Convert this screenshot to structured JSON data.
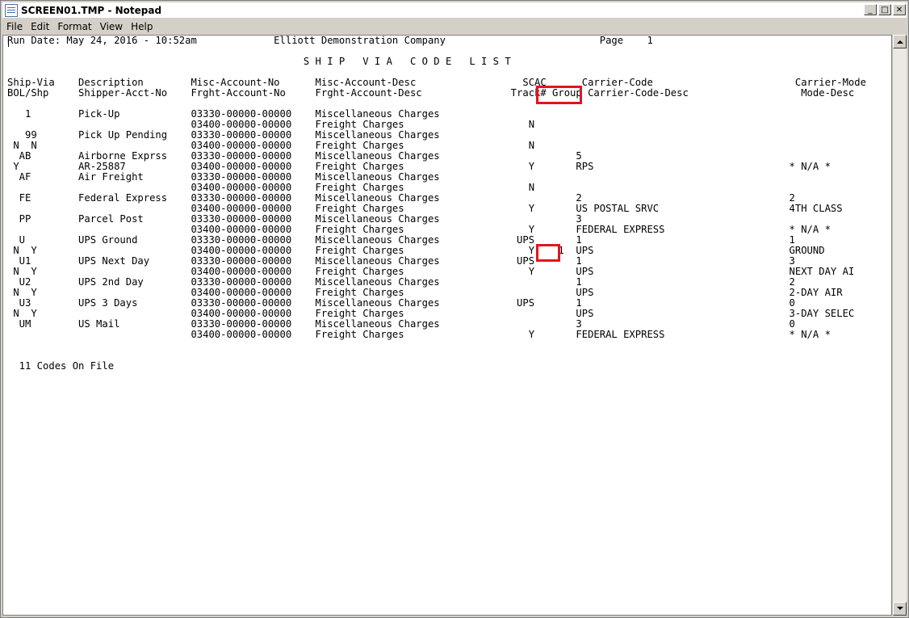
{
  "window": {
    "title": "SCREEN01.TMP - Notepad",
    "controls": {
      "minimize": "_",
      "maximize": "□",
      "close": "✕"
    }
  },
  "menu": [
    "File",
    "Edit",
    "Format",
    "View",
    "Help"
  ],
  "report": {
    "lines": [
      "Run Date: May 24, 2016 - 10:52am             Elliott Demonstration Company                          Page    1",
      "",
      "                                                  S H I P   V I A   C O D E   L I S T",
      "",
      "Ship-Via    Description        Misc-Account-No      Misc-Account-Desc                  SCAC      Carrier-Code                        Carrier-Mode",
      "BOL/Shp     Shipper-Acct-No    Frght-Account-No     Frght-Account-Desc               Track# Group Carrier-Code-Desc                   Mode-Desc",
      "",
      "   1        Pick-Up            03330-00000-00000    Miscellaneous Charges",
      "                               03400-00000-00000    Freight Charges                     N",
      "   99       Pick Up Pending    03330-00000-00000    Miscellaneous Charges",
      " N  N                          03400-00000-00000    Freight Charges                     N",
      "  AB        Airborne Exprss    03330-00000-00000    Miscellaneous Charges                       5",
      " Y          AR-25887           03400-00000-00000    Freight Charges                     Y       RPS                                 * N/A *",
      "  AF        Air Freight        03330-00000-00000    Miscellaneous Charges",
      "                               03400-00000-00000    Freight Charges                     N",
      "  FE        Federal Express    03330-00000-00000    Miscellaneous Charges                       2                                   2",
      "                               03400-00000-00000    Freight Charges                     Y       US POSTAL SRVC                      4TH CLASS",
      "  PP        Parcel Post        03330-00000-00000    Miscellaneous Charges                       3",
      "                               03400-00000-00000    Freight Charges                     Y       FEDERAL EXPRESS                     * N/A *",
      "  U         UPS Ground         03330-00000-00000    Miscellaneous Charges             UPS       1                                   1",
      " N  Y                          03400-00000-00000    Freight Charges                     Y    1  UPS                                 GROUND",
      "  U1        UPS Next Day       03330-00000-00000    Miscellaneous Charges             UPS       1                                   3",
      " N  Y                          03400-00000-00000    Freight Charges                     Y       UPS                                 NEXT DAY AI",
      "  U2        UPS 2nd Day        03330-00000-00000    Miscellaneous Charges                       1                                   2",
      " N  Y                          03400-00000-00000    Freight Charges                             UPS                                 2-DAY AIR",
      "  U3        UPS 3 Days         03330-00000-00000    Miscellaneous Charges             UPS       1                                   0",
      " N  Y                          03400-00000-00000    Freight Charges                             UPS                                 3-DAY SELEC",
      "  UM        US Mail            03330-00000-00000    Miscellaneous Charges                       3                                   0",
      "                               03400-00000-00000    Freight Charges                     Y       FEDERAL EXPRESS                     * N/A *",
      "",
      "",
      "  11 Codes On File"
    ]
  },
  "highlight_color": "#e0151f"
}
